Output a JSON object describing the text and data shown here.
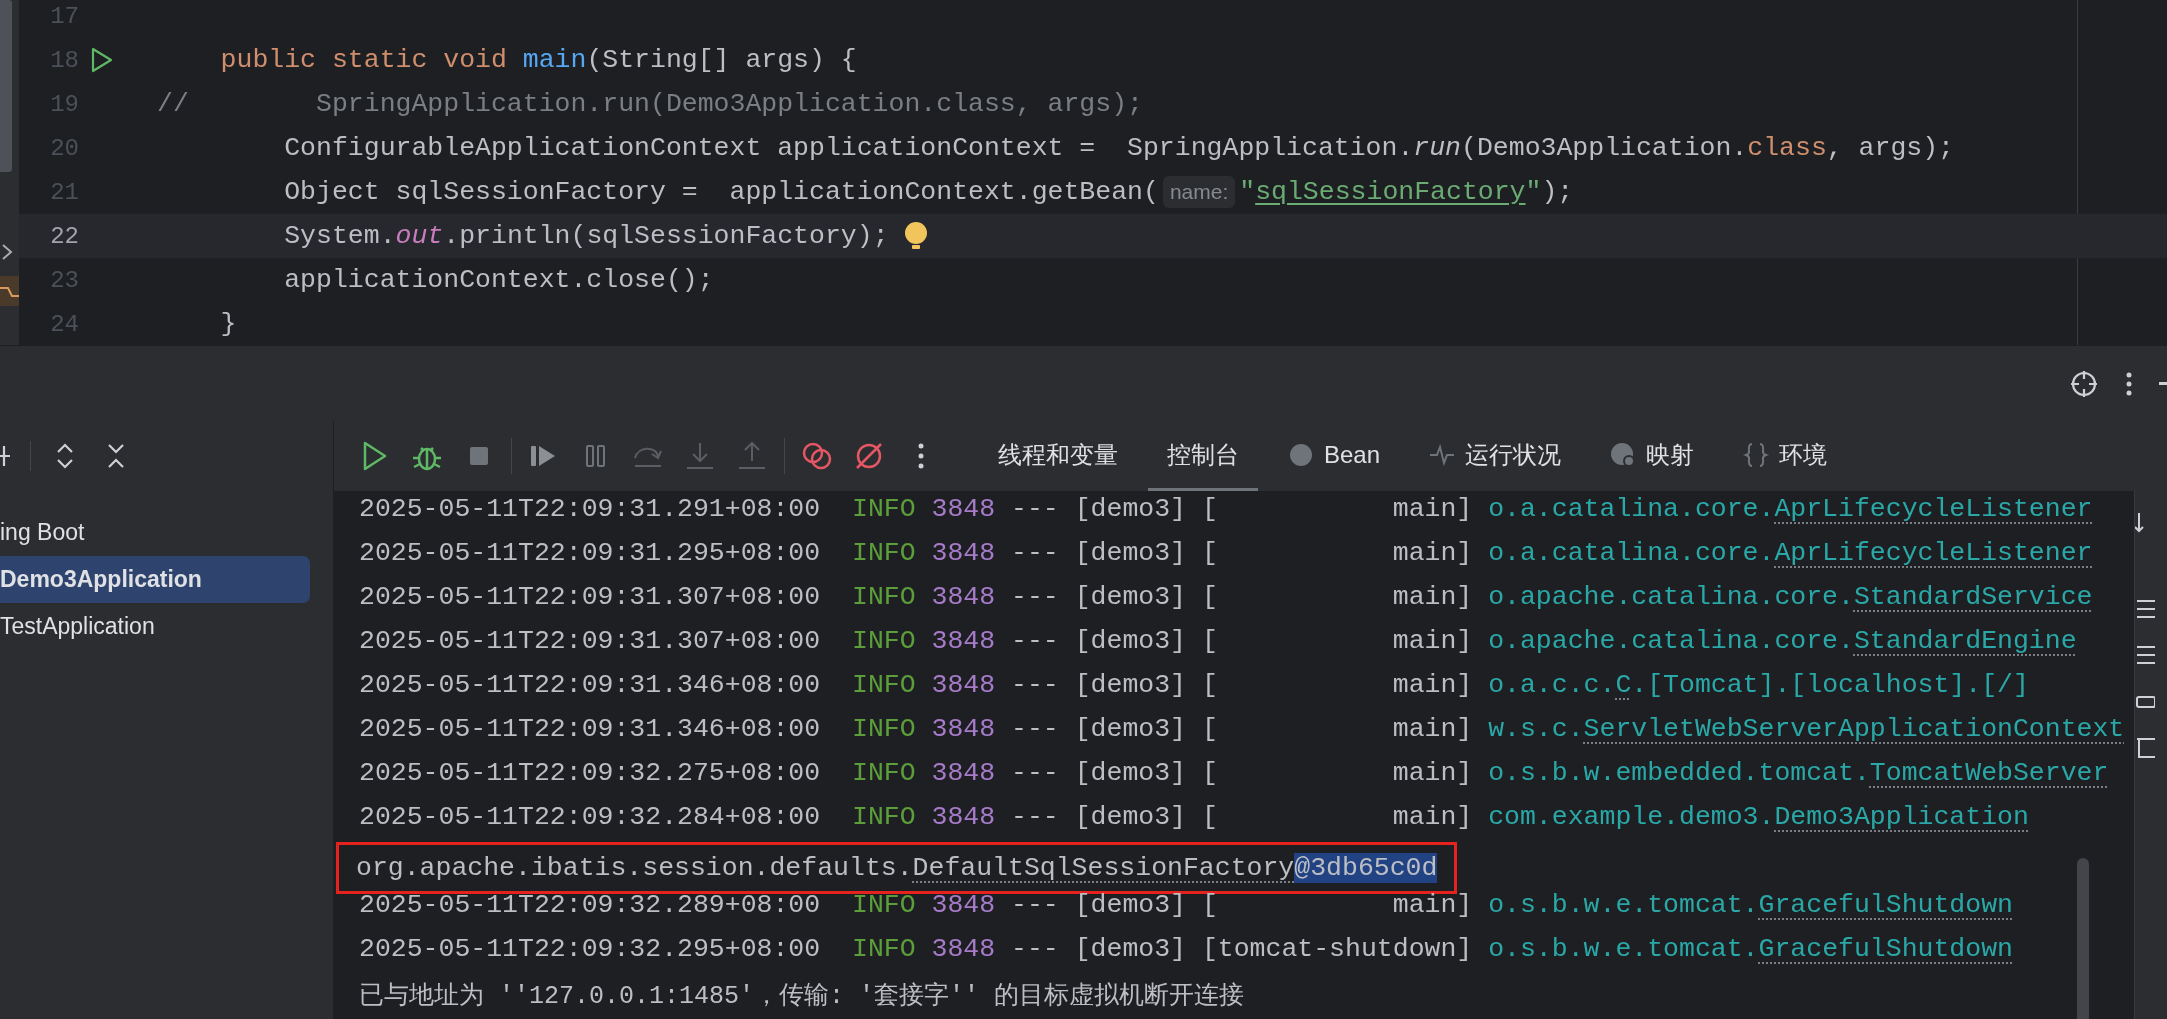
{
  "editor": {
    "lines": [
      {
        "number": "17",
        "current": false
      },
      {
        "number": "18",
        "current": false,
        "run_marker": true,
        "tokens": [
          {
            "kind": "keyword",
            "text": "    public static void "
          },
          {
            "kind": "method",
            "text": "main"
          },
          {
            "kind": "plain",
            "text": "(String[] args) {"
          }
        ]
      },
      {
        "number": "19",
        "current": false,
        "tokens": [
          {
            "kind": "comment",
            "text": "//        SpringApplication.run(Demo3Application.class, args);"
          }
        ]
      },
      {
        "number": "20",
        "current": false,
        "tokens": [
          {
            "kind": "plain",
            "text": "        ConfigurableApplicationContext applicationContext =  SpringApplication."
          },
          {
            "kind": "static_call",
            "text": "run"
          },
          {
            "kind": "plain",
            "text": "(Demo3Application."
          },
          {
            "kind": "keyword",
            "text": "class"
          },
          {
            "kind": "plain",
            "text": ", args);"
          }
        ]
      },
      {
        "number": "21",
        "current": false,
        "tokens": [
          {
            "kind": "plain",
            "text": "        Object sqlSessionFactory =  applicationContext.getBean("
          },
          {
            "kind": "hint",
            "text": "name:"
          },
          {
            "kind": "string",
            "text": "\""
          },
          {
            "kind": "string_link",
            "text": "sqlSessionFactory"
          },
          {
            "kind": "string",
            "text": "\""
          },
          {
            "kind": "plain",
            "text": ");"
          }
        ]
      },
      {
        "number": "22",
        "current": true,
        "intention_bulb": true,
        "tokens": [
          {
            "kind": "plain",
            "text": "        System."
          },
          {
            "kind": "field",
            "text": "out"
          },
          {
            "kind": "plain",
            "text": ".println(sqlSessionFactory);"
          }
        ]
      },
      {
        "number": "23",
        "current": false,
        "tokens": [
          {
            "kind": "plain",
            "text": "        applicationContext.close();"
          }
        ]
      },
      {
        "number": "24",
        "current": false,
        "tokens": [
          {
            "kind": "plain",
            "text": "    }"
          }
        ]
      }
    ]
  },
  "services": {
    "items": [
      {
        "label": "ing Boot",
        "selected": false
      },
      {
        "label": "Demo3Application",
        "selected": true
      },
      {
        "label": "TestApplication",
        "selected": false
      }
    ]
  },
  "tabs": [
    {
      "label": "线程和变量",
      "selected": false
    },
    {
      "label": "控制台",
      "selected": true
    },
    {
      "label": "Bean",
      "selected": false
    },
    {
      "label": "运行状况",
      "selected": false
    },
    {
      "label": "映射",
      "selected": false
    },
    {
      "label": "环境",
      "selected": false
    }
  ],
  "console": {
    "lines": [
      {
        "kind": "log",
        "timestamp": "2025-05-11T22:09:31.291+08:00",
        "level": "INFO",
        "pid": "3848",
        "thread": "--- [demo3] [           main]",
        "logger": [
          {
            "text": "o.a.catalina.core."
          },
          {
            "text": "AprLifecycleListener",
            "link": true
          }
        ]
      },
      {
        "kind": "log",
        "timestamp": "2025-05-11T22:09:31.295+08:00",
        "level": "INFO",
        "pid": "3848",
        "thread": "--- [demo3] [           main]",
        "logger": [
          {
            "text": "o.a.catalina.core."
          },
          {
            "text": "AprLifecycleListener",
            "link": true
          }
        ]
      },
      {
        "kind": "log",
        "timestamp": "2025-05-11T22:09:31.307+08:00",
        "level": "INFO",
        "pid": "3848",
        "thread": "--- [demo3] [           main]",
        "logger": [
          {
            "text": "o.apache.catalina.core."
          },
          {
            "text": "StandardService",
            "link": true
          }
        ]
      },
      {
        "kind": "log",
        "timestamp": "2025-05-11T22:09:31.307+08:00",
        "level": "INFO",
        "pid": "3848",
        "thread": "--- [demo3] [           main]",
        "logger": [
          {
            "text": "o.apache.catalina.core."
          },
          {
            "text": "StandardEngine",
            "link": true
          }
        ]
      },
      {
        "kind": "log",
        "timestamp": "2025-05-11T22:09:31.346+08:00",
        "level": "INFO",
        "pid": "3848",
        "thread": "--- [demo3] [           main]",
        "logger": [
          {
            "text": "o.a.c.c."
          },
          {
            "text": "C",
            "link": true
          },
          {
            "text": ".[Tomcat].[localhost].[/]"
          }
        ]
      },
      {
        "kind": "log",
        "timestamp": "2025-05-11T22:09:31.346+08:00",
        "level": "INFO",
        "pid": "3848",
        "thread": "--- [demo3] [           main]",
        "logger": [
          {
            "text": "w.s.c."
          },
          {
            "text": "ServletWebServerApplicationContext",
            "link": true
          }
        ]
      },
      {
        "kind": "log",
        "timestamp": "2025-05-11T22:09:32.275+08:00",
        "level": "INFO",
        "pid": "3848",
        "thread": "--- [demo3] [           main]",
        "logger": [
          {
            "text": "o.s.b.w.embedded.tomcat."
          },
          {
            "text": "TomcatWebServer",
            "link": true
          }
        ]
      },
      {
        "kind": "log",
        "timestamp": "2025-05-11T22:09:32.284+08:00",
        "level": "INFO",
        "pid": "3848",
        "thread": "--- [demo3] [           main]",
        "logger": [
          {
            "text": "com.example.demo3."
          },
          {
            "text": "Demo3Application",
            "link": true
          }
        ]
      },
      {
        "kind": "output",
        "highlighted": true,
        "segments": [
          {
            "text": "org.apache.ibatis.session.defaults."
          },
          {
            "text": "DefaultSqlSessionFactory",
            "link": true
          },
          {
            "text": "@3db65c0d",
            "selected": true
          }
        ]
      },
      {
        "kind": "log",
        "timestamp": "2025-05-11T22:09:32.289+08:00",
        "level": "INFO",
        "pid": "3848",
        "thread": "--- [demo3] [           main]",
        "logger": [
          {
            "text": "o.s.b.w.e.tomcat."
          },
          {
            "text": "GracefulShutdown",
            "link": true
          }
        ]
      },
      {
        "kind": "log",
        "timestamp": "2025-05-11T22:09:32.295+08:00",
        "level": "INFO",
        "pid": "3848",
        "thread": "--- [demo3] [tomcat-shutdown]",
        "logger": [
          {
            "text": "o.s.b.w.e.tomcat."
          },
          {
            "text": "GracefulShutdown",
            "link": true
          }
        ]
      },
      {
        "kind": "message",
        "text": "已与地址为 ''127.0.0.1:1485'，传输: '套接字'' 的目标虚拟机断开连接"
      }
    ]
  }
}
